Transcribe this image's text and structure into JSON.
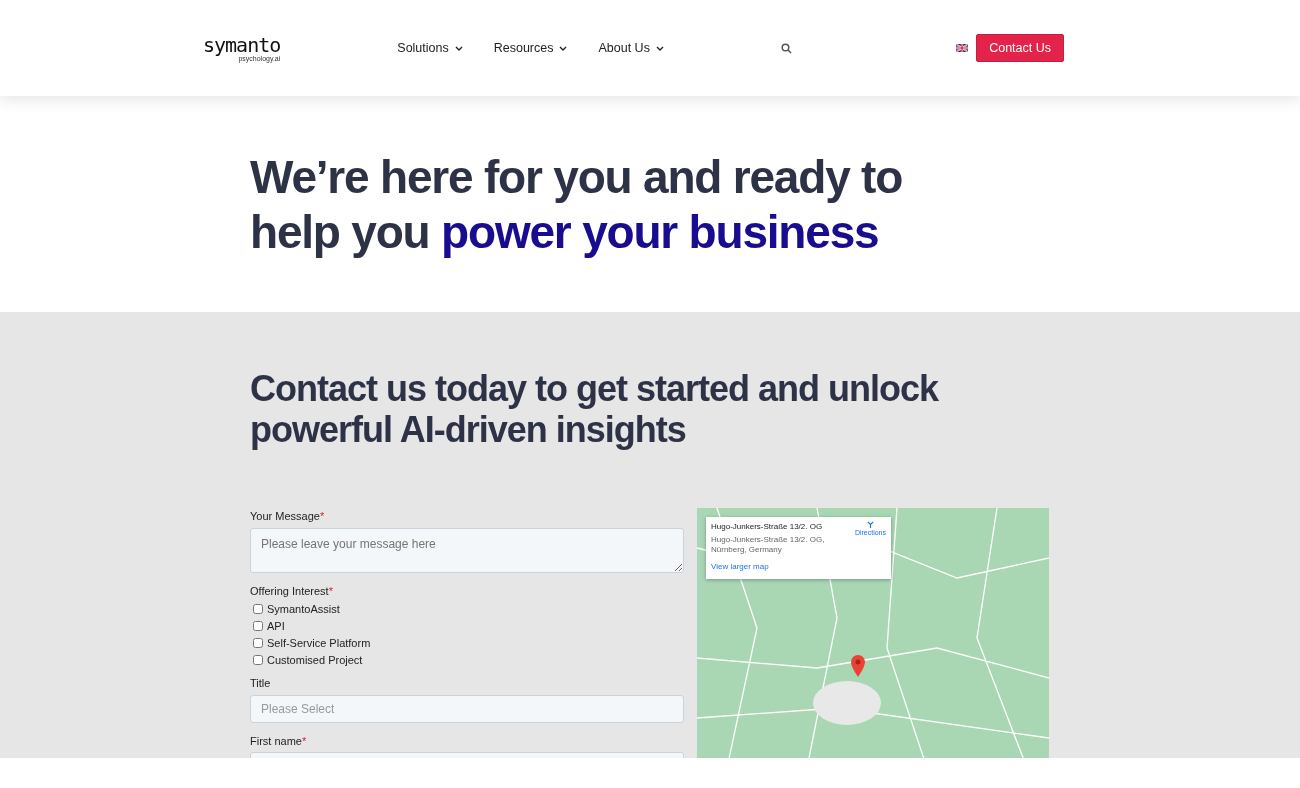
{
  "header": {
    "logo": {
      "name": "symanto",
      "tagline": "psychology.ai"
    },
    "nav": [
      {
        "label": "Solutions",
        "has_dropdown": true
      },
      {
        "label": "Resources",
        "has_dropdown": true
      },
      {
        "label": "About Us",
        "has_dropdown": true
      }
    ],
    "cta": "Contact Us"
  },
  "hero": {
    "heading": "We’re here for you and ready to help you",
    "highlight": "power your business"
  },
  "contact": {
    "heading": "Contact us today to get started and unlock powerful AI-driven insights",
    "form": [
      {
        "kind": "textarea",
        "label": "Your Message",
        "required_mark": "*",
        "placeholder": "Please leave your message here"
      },
      {
        "kind": "checkboxes",
        "label": "Offering Interest",
        "required_mark": "*",
        "options": [
          {
            "label": "SymantoAssist",
            "checked": false
          },
          {
            "label": "API",
            "checked": false
          },
          {
            "label": "Self-Service Platform",
            "checked": false
          },
          {
            "label": "Customised Project",
            "checked": false
          }
        ]
      },
      {
        "kind": "select",
        "label": "Title",
        "placeholder": "Please Select"
      },
      {
        "kind": "text",
        "label": "First name",
        "required_mark": "*"
      }
    ],
    "map": {
      "card": {
        "title": "Hugo-Junkers-Straße 13/2. OG",
        "address": "Hugo-Junkers-Straße 13/2. OG, Nürnberg, Germany",
        "directions": "Directions",
        "link": "View larger map"
      }
    }
  }
}
